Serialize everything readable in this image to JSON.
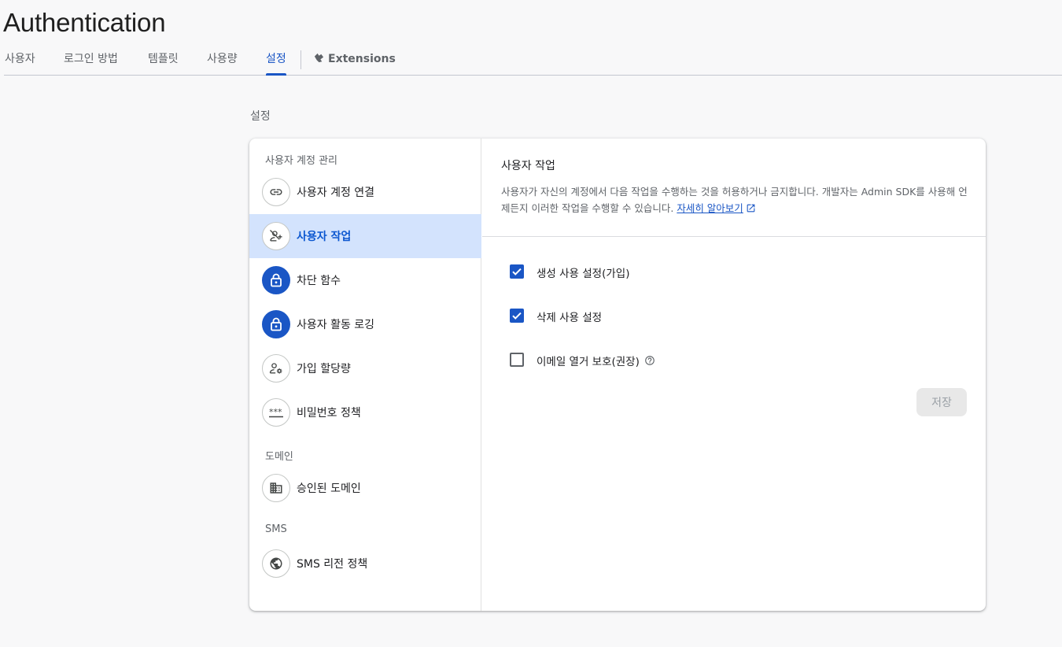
{
  "page": {
    "title": "Authentication"
  },
  "tabs": [
    {
      "label": "사용자"
    },
    {
      "label": "로그인 방법"
    },
    {
      "label": "템플릿"
    },
    {
      "label": "사용량"
    },
    {
      "label": "설정",
      "active": true
    },
    {
      "label": "Extensions",
      "icon": "extensions-icon"
    }
  ],
  "settings": {
    "heading": "설정",
    "nav": {
      "groups": [
        {
          "label": "사용자 계정 관리",
          "items": [
            {
              "label": "사용자 계정 연결",
              "icon": "link-icon"
            },
            {
              "label": "사용자 작업",
              "icon": "person-off-add-icon",
              "selected": true
            },
            {
              "label": "차단 함수",
              "icon": "lock-icon"
            },
            {
              "label": "사용자 활동 로깅",
              "icon": "lock-icon"
            },
            {
              "label": "가입 할당량",
              "icon": "manage-accounts-icon"
            },
            {
              "label": "비밀번호 정책",
              "icon": "password-icon"
            }
          ]
        },
        {
          "label": "도메인",
          "items": [
            {
              "label": "승인된 도메인",
              "icon": "domain-icon"
            }
          ]
        },
        {
          "label": "SMS",
          "items": [
            {
              "label": "SMS 리전 정책",
              "icon": "globe-icon"
            }
          ]
        }
      ]
    },
    "content": {
      "title": "사용자 작업",
      "description": "사용자가 자신의 계정에서 다음 작업을 수행하는 것을 허용하거나 금지합니다. 개발자는 Admin SDK를 사용해 언제든지 이러한 작업을 수행할 수 있습니다.",
      "learn_more": "자세히 알아보기",
      "options": [
        {
          "label": "생성 사용 설정(가입)",
          "checked": true
        },
        {
          "label": "삭제 사용 설정",
          "checked": true
        },
        {
          "label": "이메일 열거 보호(권장)",
          "checked": false,
          "help_icon": "help-icon"
        }
      ],
      "save_label": "저장"
    }
  },
  "colors": {
    "accent": "#1a56c5",
    "selected_bg": "#d3e3fd",
    "page_bg": "#f8f8f9"
  }
}
